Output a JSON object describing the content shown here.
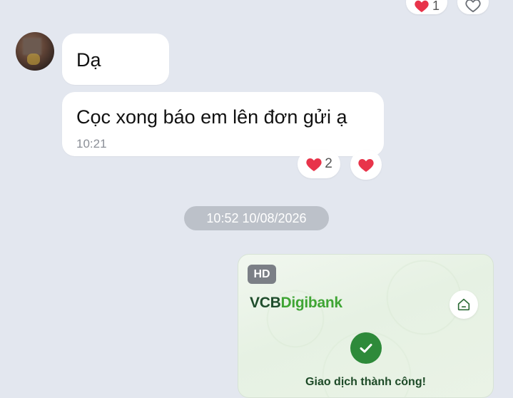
{
  "top_reactions": {
    "heart_count": "1"
  },
  "incoming": {
    "messages": [
      {
        "text": "Dạ"
      },
      {
        "text": "Cọc xong báo em lên đơn gửi ạ",
        "time": "10:21"
      }
    ],
    "reactions": {
      "heart_count": "2"
    }
  },
  "timestamp_divider": "10:52 10/08/2026",
  "outgoing_image": {
    "quality_badge": "HD",
    "brand_vcb": "VCB",
    "brand_digibank": "Digibank",
    "status_text": "Giao dịch thành công!"
  },
  "colors": {
    "background": "#e3e7ef",
    "bubble": "#ffffff",
    "heart": "#e8344a",
    "vcb_green": "#1f4d2c",
    "digibank_green": "#3fa534",
    "check_green": "#2e8a3a"
  }
}
